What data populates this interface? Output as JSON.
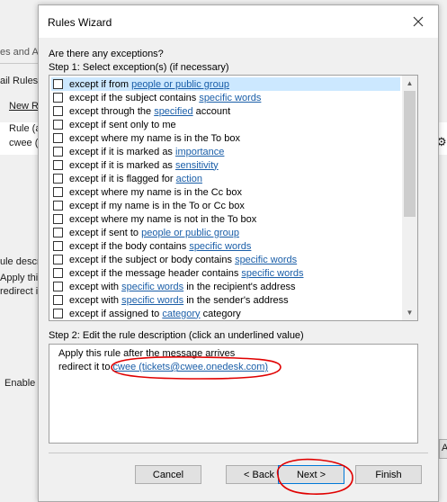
{
  "background": {
    "frag_1": "es and A",
    "frag_2": "ail Rules",
    "frag_3": "New R",
    "frag_4": "Rule (a",
    "frag_5": "cwee (",
    "frag_6": "ule descr",
    "frag_7": "Apply thi",
    "frag_8": "redirect i",
    "frag_9": "Enable",
    "frag_10": "A"
  },
  "dialog": {
    "title": "Rules Wizard",
    "question": "Are there any exceptions?",
    "step1_label": "Step 1: Select exception(s) (if necessary)",
    "exceptions": [
      {
        "parts": [
          {
            "t": "except if from "
          },
          {
            "t": "people or public group",
            "link": true
          }
        ],
        "checked": false,
        "selected": true
      },
      {
        "parts": [
          {
            "t": "except if the subject contains "
          },
          {
            "t": "specific words",
            "link": true
          }
        ],
        "checked": false
      },
      {
        "parts": [
          {
            "t": "except through the "
          },
          {
            "t": "specified",
            "link": true
          },
          {
            "t": " account"
          }
        ],
        "checked": false
      },
      {
        "parts": [
          {
            "t": "except if sent only to me"
          }
        ],
        "checked": false
      },
      {
        "parts": [
          {
            "t": "except where my name is in the To box"
          }
        ],
        "checked": false
      },
      {
        "parts": [
          {
            "t": "except if it is marked as "
          },
          {
            "t": "importance",
            "link": true
          }
        ],
        "checked": false
      },
      {
        "parts": [
          {
            "t": "except if it is marked as "
          },
          {
            "t": "sensitivity",
            "link": true
          }
        ],
        "checked": false
      },
      {
        "parts": [
          {
            "t": "except if it is flagged for "
          },
          {
            "t": "action",
            "link": true
          }
        ],
        "checked": false
      },
      {
        "parts": [
          {
            "t": "except where my name is in the Cc box"
          }
        ],
        "checked": false
      },
      {
        "parts": [
          {
            "t": "except if my name is in the To or Cc box"
          }
        ],
        "checked": false
      },
      {
        "parts": [
          {
            "t": "except where my name is not in the To box"
          }
        ],
        "checked": false
      },
      {
        "parts": [
          {
            "t": "except if sent to "
          },
          {
            "t": "people or public group",
            "link": true
          }
        ],
        "checked": false
      },
      {
        "parts": [
          {
            "t": "except if the body contains "
          },
          {
            "t": "specific words",
            "link": true
          }
        ],
        "checked": false
      },
      {
        "parts": [
          {
            "t": "except if the subject or body contains "
          },
          {
            "t": "specific words",
            "link": true
          }
        ],
        "checked": false
      },
      {
        "parts": [
          {
            "t": "except if the message header contains "
          },
          {
            "t": "specific words",
            "link": true
          }
        ],
        "checked": false
      },
      {
        "parts": [
          {
            "t": "except with "
          },
          {
            "t": "specific words",
            "link": true
          },
          {
            "t": " in the recipient's address"
          }
        ],
        "checked": false
      },
      {
        "parts": [
          {
            "t": "except with "
          },
          {
            "t": "specific words",
            "link": true
          },
          {
            "t": " in the sender's address"
          }
        ],
        "checked": false
      },
      {
        "parts": [
          {
            "t": "except if assigned to "
          },
          {
            "t": "category",
            "link": true
          },
          {
            "t": " category"
          }
        ],
        "checked": false
      }
    ],
    "step2_label": "Step 2: Edit the rule description (click an underlined value)",
    "description": {
      "line1": "Apply this rule after the message arrives",
      "line2_prefix": "redirect it to ",
      "line2_link": "cwee (tickets@cwee.onedesk.com)"
    },
    "buttons": {
      "cancel": "Cancel",
      "back": "< Back",
      "next": "Next >",
      "finish": "Finish"
    },
    "annotation_color": "#e00000"
  }
}
